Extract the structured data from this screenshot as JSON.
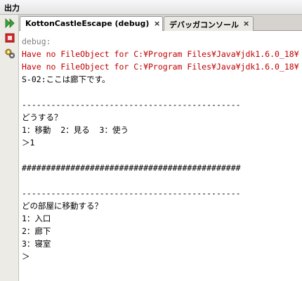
{
  "window": {
    "title": "出力"
  },
  "tabs": [
    {
      "label": "KottonCastleEscape (debug)",
      "close": "×"
    },
    {
      "label": "デバッガコンソール",
      "close": "×"
    }
  ],
  "toolbar": {
    "rerun_icon": "double-play-icon",
    "stop_icon": "stop-icon",
    "settings_icon": "settings-icon",
    "accent_green": "#2f9a2f",
    "accent_red": "#c00000"
  },
  "console": {
    "lines": [
      {
        "text": "debug:",
        "color": "gray"
      },
      {
        "text": "Have no FileObject for C:¥Program Files¥Java¥jdk1.6.0_18¥",
        "color": "red"
      },
      {
        "text": "Have no FileObject for C:¥Program Files¥Java¥jdk1.6.0_18¥",
        "color": "red"
      },
      {
        "text": "S-02:ここは廊下です。",
        "color": "black"
      },
      {
        "text": "",
        "color": "black"
      },
      {
        "text": "---------------------------------------------",
        "color": "black"
      },
      {
        "text": "どうする？",
        "color": "black"
      },
      {
        "text": "1：移動  2：見る  3：使う",
        "color": "black"
      },
      {
        "text": "＞1",
        "color": "black"
      },
      {
        "text": "",
        "color": "black"
      },
      {
        "text": "#############################################",
        "color": "black"
      },
      {
        "text": "",
        "color": "black"
      },
      {
        "text": "---------------------------------------------",
        "color": "black"
      },
      {
        "text": "どの部屋に移動する？",
        "color": "black"
      },
      {
        "text": "1：入口",
        "color": "black"
      },
      {
        "text": "2：廊下",
        "color": "black"
      },
      {
        "text": "3：寝室",
        "color": "black"
      },
      {
        "text": "＞",
        "color": "black"
      }
    ]
  }
}
